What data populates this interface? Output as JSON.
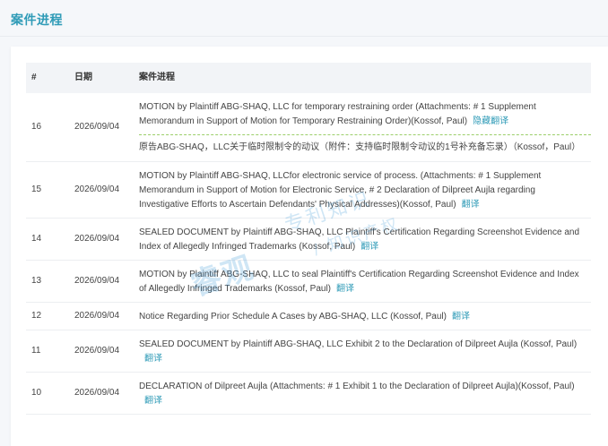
{
  "section": {
    "title": "案件进程"
  },
  "table": {
    "headers": {
      "num": "#",
      "date": "日期",
      "progress": "案件进程"
    },
    "rows": [
      {
        "num": "16",
        "date": "2026/09/04",
        "text": "MOTION by Plaintiff ABG-SHAQ, LLC for temporary restraining order (Attachments: # 1 Supplement Memorandum in Support of Motion for Temporary Restraining Order)(Kossof, Paul)",
        "action": "隐藏翻译",
        "translation": "原告ABG-SHAQ，LLC关于临时限制令的动议（附件：支持临时限制令动议的1号补充备忘录）（Kossof，Paul）"
      },
      {
        "num": "15",
        "date": "2026/09/04",
        "text": "MOTION by Plaintiff ABG-SHAQ, LLCfor electronic service of process. (Attachments: # 1 Supplement Memorandum in Support of Motion for Electronic Service, # 2 Declaration of Dilpreet Aujla regarding Investigative Efforts to Ascertain Defendants' Physical Addresses)(Kossof, Paul)",
        "action": "翻译"
      },
      {
        "num": "14",
        "date": "2026/09/04",
        "text": "SEALED DOCUMENT by Plaintiff ABG-SHAQ, LLC Plaintiff's Certification Regarding Screenshot Evidence and Index of Allegedly Infringed Trademarks (Kossof, Paul)",
        "action": "翻译"
      },
      {
        "num": "13",
        "date": "2026/09/04",
        "text": "MOTION by Plaintiff ABG-SHAQ, LLC to seal Plaintiff's Certification Regarding Screenshot Evidence and Index of Allegedly Infringed Trademarks (Kossof, Paul)",
        "action": "翻译"
      },
      {
        "num": "12",
        "date": "2026/09/04",
        "text": "Notice Regarding Prior Schedule A Cases by ABG-SHAQ, LLC (Kossof, Paul)",
        "action": "翻译"
      },
      {
        "num": "11",
        "date": "2026/09/04",
        "text": "SEALED DOCUMENT by Plaintiff ABG-SHAQ, LLC Exhibit 2 to the Declaration of Dilpreet Aujla (Kossof, Paul)",
        "action": "翻译"
      },
      {
        "num": "10",
        "date": "2026/09/04",
        "text": "DECLARATION of Dilpreet Aujla (Attachments: # 1 Exhibit 1 to the Declaration of Dilpreet Aujla)(Kossof, Paul)",
        "action": "翻译"
      }
    ]
  },
  "watermark": {
    "logo": "睿观",
    "line1": "专利知识",
    "line2": "/ 知识产权"
  }
}
